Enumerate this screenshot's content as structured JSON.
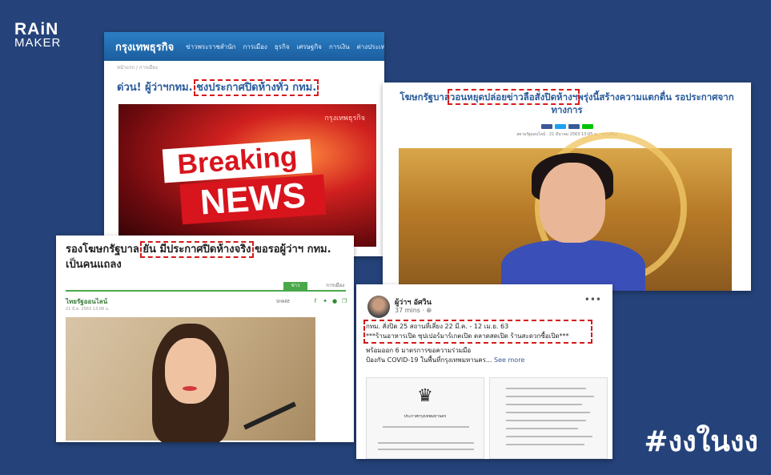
{
  "brand": {
    "line1": "RAiN",
    "line2": "MAKER"
  },
  "hashtag": "#งงในงง",
  "card1": {
    "site_name": "กรุงเทพธุรกิจ",
    "nav": [
      "ข่าวพระราชสำนัก",
      "การเมือง",
      "ธุรกิจ",
      "เศรษฐกิจ",
      "การเงิน",
      "ต่างประเทศ"
    ],
    "breadcrumb": "หน้าแรก / การเมือง",
    "headline_pre": "ด่วน! ผู้ว่าฯกทม.",
    "headline_mark": "ชงประกาศปิดห้างทั่ว กทม.",
    "image_watermark": "กรุงเทพธุรกิจ",
    "image_text1": "Breaking",
    "image_text2": "NEWS"
  },
  "card2": {
    "headline_pre": "โฆษกรัฐบาล",
    "headline_mark": "วอนหยุดปล่อยข่าวลือสั่งปิดห้างฯ",
    "headline_post": "พรุ่งนี้สร้างความแตกตื่น รอประกาศจากทางการ",
    "meta": "สยามรัฐออนไลน์ · 21 มีนาคม 2563 13:05 น. · การเมือง"
  },
  "card3": {
    "headline_pre": "รองโฆษกรัฐบาล",
    "headline_mark": "ยัน มีประกาศปิดห้างจริง",
    "headline_post": "ขอรอผู้ว่าฯ กทม. เป็นคนแถลง",
    "tab_active": "ข่าว",
    "tab_other": "การเมือง",
    "source": "ไทยรัฐออนไลน์",
    "source_date": "21 มี.ค. 2563 13:08 น.",
    "share_label": "SHARE"
  },
  "card4": {
    "author": "ผู้ว่าฯ อัศวิน",
    "time": "37 mins",
    "marked_line1": "กทม. สั่งปิด 25 สถานที่เสี่ยง 22 มี.ค. - 12 เม.ย. 63",
    "marked_line2": "***ร้านอาหารเปิด ซุปเปอร์มาร์เกตเปิด ตลาดสดเปิด ร้านสะดวกซื้อเปิด***",
    "line3": "พร้อมออก 6 มาตรการขอความร่วมมือ",
    "line4": "ป้องกัน COVID-19 ในพื้นที่กรุงเทพมหานคร...",
    "see_more": "See more",
    "doc_title": "ประกาศกรุงเทพมหานคร"
  }
}
